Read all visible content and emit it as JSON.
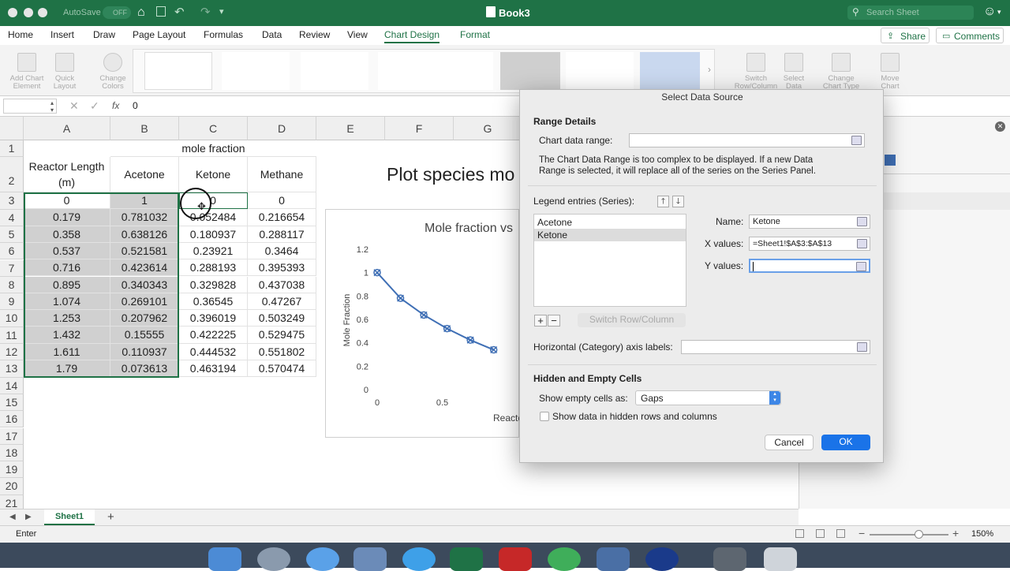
{
  "titlebar": {
    "autosave": "AutoSave",
    "autosave_state": "OFF",
    "doc_title": "Book3",
    "search_placeholder": "Search Sheet"
  },
  "ribbon": {
    "tabs": [
      "Home",
      "Insert",
      "Draw",
      "Page Layout",
      "Formulas",
      "Data",
      "Review",
      "View",
      "Chart Design",
      "Format"
    ],
    "active_tab": "Chart Design",
    "share": "Share",
    "comments": "Comments"
  },
  "toolbar": {
    "add_chart_element": "Add Chart Element",
    "quick_layout": "Quick Layout",
    "change_colors": "Change Colors",
    "switch_row_col": "Switch Row/Column",
    "select_data": "Select Data",
    "change_chart_type": "Change Chart Type",
    "move_chart": "Move Chart"
  },
  "formula_bar": {
    "name_box": "",
    "fx": "fx",
    "value": "0"
  },
  "sheet": {
    "columns": [
      "A",
      "B",
      "C",
      "D",
      "E",
      "F",
      "G"
    ],
    "rows": [
      "1",
      "2",
      "3",
      "4",
      "5",
      "6",
      "7",
      "8",
      "9",
      "10",
      "11",
      "12",
      "13",
      "14",
      "15",
      "16",
      "17",
      "18",
      "19",
      "20",
      "21"
    ],
    "header_row1": "mole fraction",
    "header_row2": [
      "Reactor Length (m)",
      "Acetone",
      "Ketone",
      "Methane"
    ],
    "data": [
      [
        "0",
        "1",
        "0",
        "0"
      ],
      [
        "0.179",
        "0.781032",
        "0.052484",
        "0.216654"
      ],
      [
        "0.358",
        "0.638126",
        "0.180937",
        "0.288117"
      ],
      [
        "0.537",
        "0.521581",
        "0.23921",
        "0.3464"
      ],
      [
        "0.716",
        "0.423614",
        "0.288193",
        "0.395393"
      ],
      [
        "0.895",
        "0.340343",
        "0.329828",
        "0.437038"
      ],
      [
        "1.074",
        "0.269101",
        "0.36545",
        "0.47267"
      ],
      [
        "1.253",
        "0.207962",
        "0.396019",
        "0.503249"
      ],
      [
        "1.432",
        "0.15555",
        "0.422225",
        "0.529475"
      ],
      [
        "1.611",
        "0.110937",
        "0.444532",
        "0.551802"
      ],
      [
        "1.79",
        "0.073613",
        "0.463194",
        "0.570474"
      ]
    ],
    "overlay_text": "Plot species mo",
    "sheet_tab": "Sheet1",
    "add_sheet": "+"
  },
  "chart_data": {
    "type": "scatter",
    "title": "Mole fraction vs",
    "ylabel": "Mole Fraction",
    "xlabel": "Reacto",
    "x_ticks": [
      "0",
      "0.5"
    ],
    "y_ticks": [
      "0",
      "0.2",
      "0.4",
      "0.6",
      "0.8",
      "1",
      "1.2"
    ],
    "ylim": [
      0,
      1.2
    ],
    "xlim": [
      0,
      1.0
    ],
    "series": [
      {
        "x": [
          0,
          0.179,
          0.358,
          0.537,
          0.716,
          0.895
        ],
        "values": [
          1,
          0.781032,
          0.638126,
          0.521581,
          0.423614,
          0.340343
        ]
      }
    ],
    "color": "#3f6fb5"
  },
  "dialog": {
    "title": "Select Data Source",
    "range_details": "Range Details",
    "chart_data_range_label": "Chart data range:",
    "chart_data_range_value": "",
    "notice": "The Chart Data Range is too complex to be displayed. If a new Data Range is selected, it will replace all of the series on the Series Panel.",
    "legend_entries": "Legend entries (Series):",
    "series": [
      "Acetone",
      "Ketone"
    ],
    "selected_series": "Ketone",
    "name_label": "Name:",
    "name_value": "Ketone",
    "x_label": "X values:",
    "x_value": "=Sheet1!$A$3:$A$13",
    "y_label": "Y values:",
    "y_value": "",
    "add": "+",
    "remove": "−",
    "switch": "Switch Row/Column",
    "horiz_axis_labels": "Horizontal (Category) axis labels:",
    "hidden_empty": "Hidden and Empty Cells",
    "show_empty_label": "Show empty cells as:",
    "show_empty_value": "Gaps",
    "show_hidden": "Show data in hidden rows and columns",
    "cancel": "Cancel",
    "ok": "OK"
  },
  "status": {
    "mode": "Enter",
    "zoom": "150%"
  },
  "colors": {
    "excel_green": "#1f7246",
    "accent_blue": "#1a73e8",
    "series_blue": "#3f6fb5"
  }
}
